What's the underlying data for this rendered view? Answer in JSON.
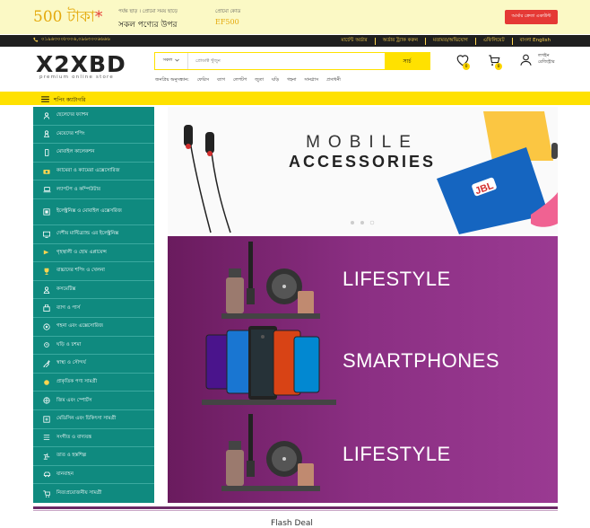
{
  "promo": {
    "amount": "500 টাকা",
    "asterisk": "*",
    "line1": "পর্যন্ত ছাড় । প্রোমো সময় ছাড়ে",
    "line2": "সকল পণ্যের উপর",
    "code_label": "প্রোমো কোড",
    "code_value": "EF500",
    "cta": "আর্মার ক্রেতা একাউন্ট"
  },
  "topbar": {
    "phone": "০১৯৬৩০০৮০০৬,০৯৬৩০০৬৬৬৬",
    "links": [
      "মার্চেন্ট অর্ডার",
      "অর্ডার ট্র্যাক করুন",
      "মতামত/অভিযোগ",
      "এফিলিয়েট",
      "বাংলা English"
    ]
  },
  "logo": {
    "text": "X2XBD",
    "tagline": "premium online store"
  },
  "search": {
    "category": "সকল",
    "placeholder": "প্রোডাক্ট খুঁজুন",
    "button": "সার্চ"
  },
  "quick_cats": [
    "জনপ্রিয় অনুসন্ধান:",
    "ফেরিস",
    "ব্যাগ",
    "লেপটপ",
    "জুতা",
    "ঘড়ি",
    "গহনা",
    "সানগ্লাস",
    "প্রসাধনী"
  ],
  "header": {
    "wishlist_count": "0",
    "cart_count": "0",
    "login": "লগইন",
    "register": "রেজিস্ট্রার"
  },
  "categories_bar": {
    "label": "শপিং ক্যাটাগরি"
  },
  "sidebar": {
    "items": [
      {
        "label": "ছেলেদের ফ্যাশন",
        "icon": "man-icon"
      },
      {
        "label": "মেয়েদের শপিং",
        "icon": "woman-icon"
      },
      {
        "label": "মোবাইল কালেকশন",
        "icon": "mobile-icon"
      },
      {
        "label": "ক্যামেরা ও ক্যামেরা এক্সেসোরিজ",
        "icon": "camera-icon"
      },
      {
        "label": "ল্যাপটপ ও কম্পিউটার",
        "icon": "laptop-icon"
      },
      {
        "label": "ইলেক্ট্রনিক্স ও মোবাইল এক্সেসরিজ",
        "icon": "electronics-icon"
      },
      {
        "label": "দেশীয় মাল্টিব্র্যান্ড এর ইলেক্ট্রনিক্স",
        "icon": "tv-icon"
      },
      {
        "label": "গৃহস্থালী ও হোম এপ্লায়েন্স",
        "icon": "plug-icon"
      },
      {
        "label": "বাচ্চাদের শপিং ও খেলনা",
        "icon": "toy-icon"
      },
      {
        "label": "কসমেটিক্স",
        "icon": "cosmetics-icon"
      },
      {
        "label": "ব্যাগ ও পার্স",
        "icon": "bag-icon"
      },
      {
        "label": "গহনা এবং এক্সেসোরিজ",
        "icon": "jewelry-icon"
      },
      {
        "label": "ঘড়ি ও চশমা",
        "icon": "watch-icon"
      },
      {
        "label": "স্বাস্থ্য ও সৌন্দর্য",
        "icon": "health-icon"
      },
      {
        "label": "প্রাকৃতিক পণ্য সামগ্রী",
        "icon": "leaf-icon"
      },
      {
        "label": "জিম এবং স্পোর্টস",
        "icon": "sports-icon"
      },
      {
        "label": "মেডিসিন এবং চিকিৎসা সামগ্রী",
        "icon": "medicine-icon"
      },
      {
        "label": "সংগীত ও বাদ্যযন্ত্র",
        "icon": "music-icon"
      },
      {
        "label": "তাত ও হস্তশিল্প",
        "icon": "craft-icon"
      },
      {
        "label": "যানবাহন",
        "icon": "car-icon"
      },
      {
        "label": "নিত্যপ্রয়োজনীয় সামগ্রী",
        "icon": "grocery-icon"
      }
    ]
  },
  "slider": {
    "line1": "MOBILE",
    "line2": "ACCESSORIES",
    "brand": "JBL"
  },
  "banners": [
    "LIFESTYLE",
    "SMARTPHONES",
    "LIFESTYLE"
  ],
  "footer": {
    "subtitle": "Flash Deal"
  },
  "colors": {
    "sidebar": "#0f8a7f",
    "accent_yellow": "#ffe100",
    "promo_red": "#e53935",
    "banner_purple": "#8b2f83"
  }
}
